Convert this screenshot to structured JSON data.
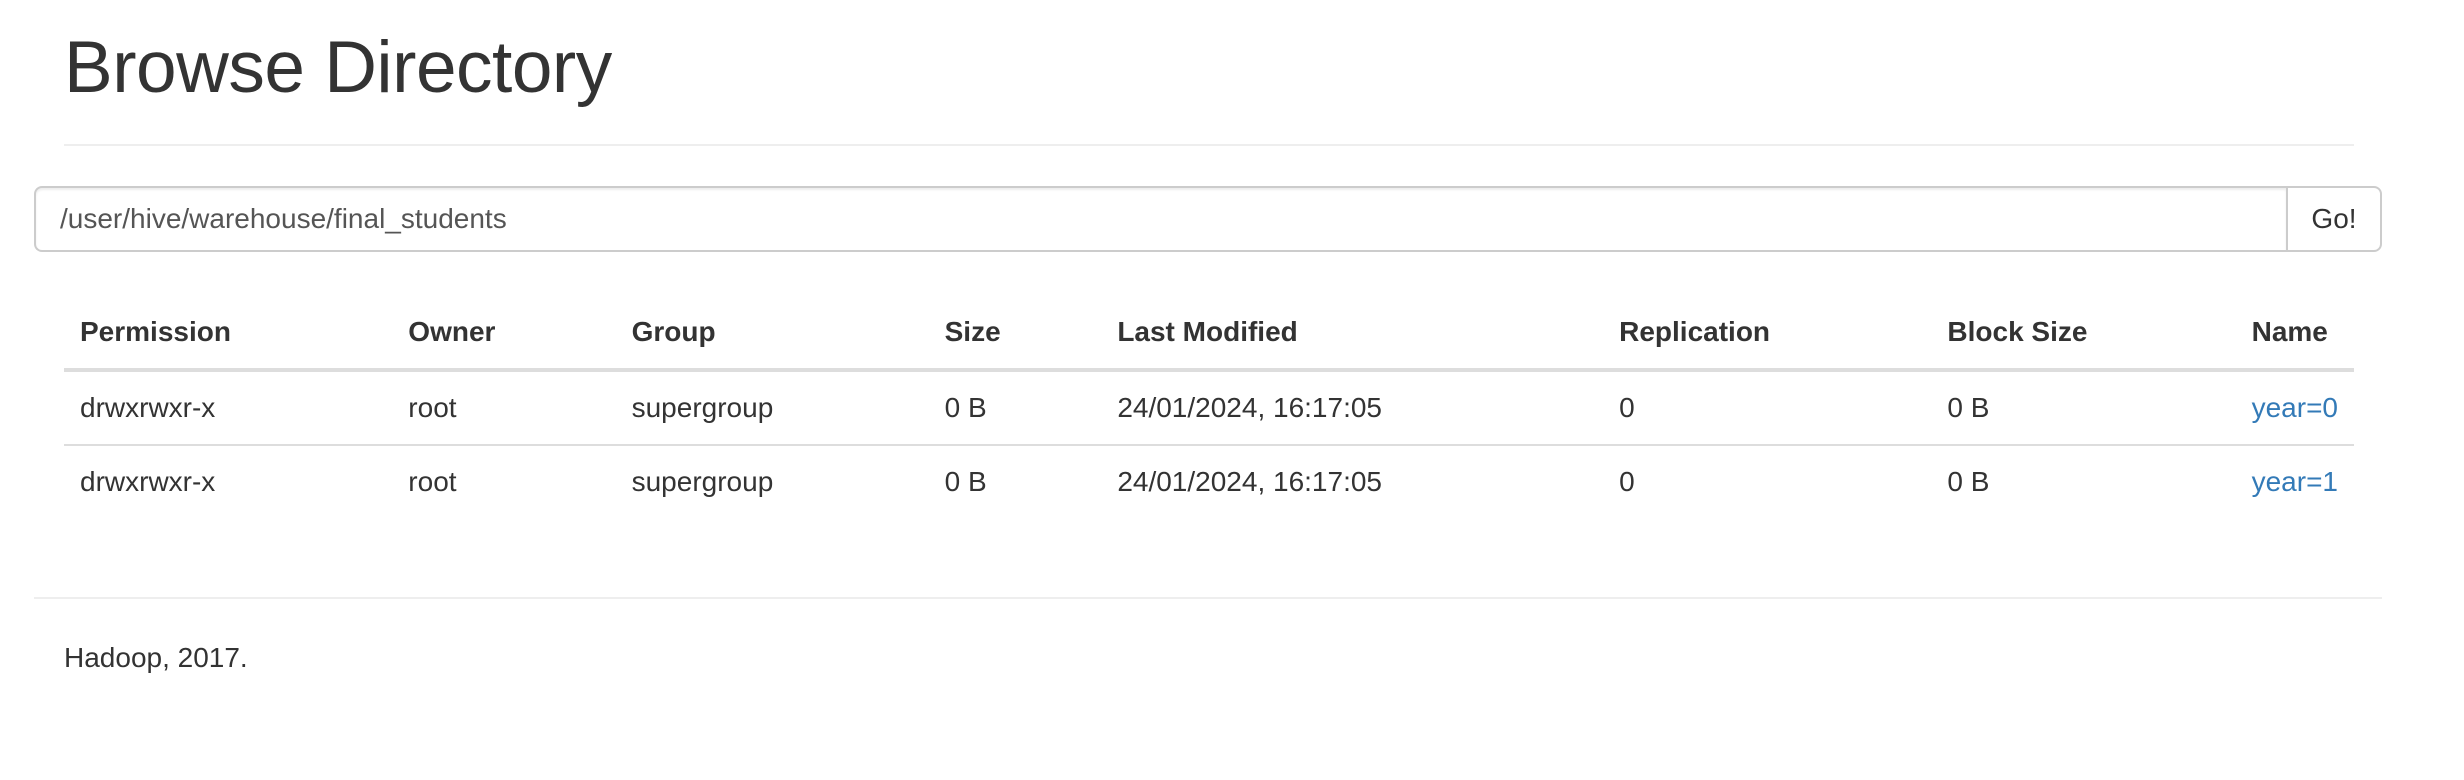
{
  "header": {
    "title": "Browse Directory"
  },
  "path_bar": {
    "value": "/user/hive/warehouse/final_students",
    "go_label": "Go!"
  },
  "table": {
    "columns": [
      "Permission",
      "Owner",
      "Group",
      "Size",
      "Last Modified",
      "Replication",
      "Block Size",
      "Name"
    ],
    "rows": [
      {
        "permission": "drwxrwxr-x",
        "owner": "root",
        "group": "supergroup",
        "size": "0 B",
        "last_modified": "24/01/2024, 16:17:05",
        "replication": "0",
        "block_size": "0 B",
        "name": "year=0"
      },
      {
        "permission": "drwxrwxr-x",
        "owner": "root",
        "group": "supergroup",
        "size": "0 B",
        "last_modified": "24/01/2024, 16:17:05",
        "replication": "0",
        "block_size": "0 B",
        "name": "year=1"
      }
    ]
  },
  "footer": {
    "text": "Hadoop, 2017."
  },
  "colors": {
    "link": "#337ab7",
    "text": "#333333",
    "border": "#dddddd"
  }
}
